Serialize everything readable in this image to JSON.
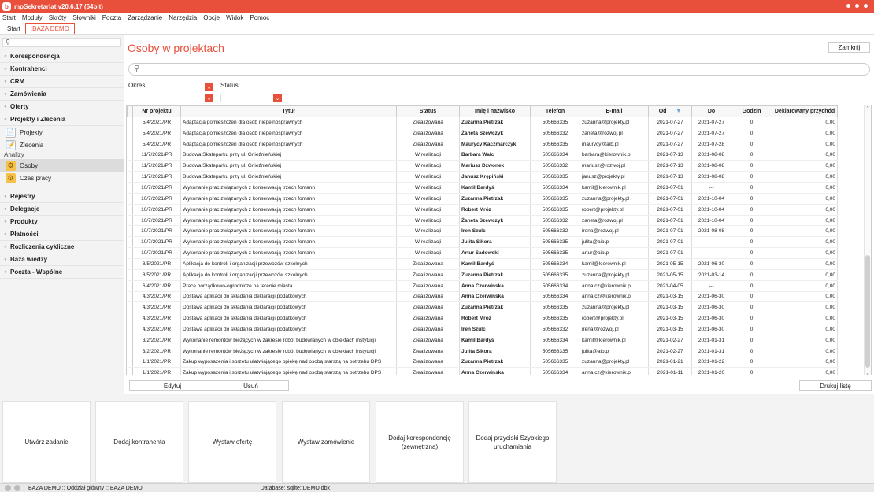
{
  "window": {
    "title": "mpSekretariat v20.6.17 (64bit)"
  },
  "menu": [
    "Start",
    "Moduły",
    "Skróty",
    "Słowniki",
    "Poczta",
    "Zarządzanie",
    "Narzędzia",
    "Opcje",
    "Widok",
    "Pomoc"
  ],
  "tabs": [
    "Start",
    ":BAZA DEMO"
  ],
  "sidebar": {
    "sections_top": [
      "Korespondencja",
      "Kontrahenci",
      "CRM",
      "Zamówienia",
      "Oferty",
      "Projekty i Zlecenia"
    ],
    "items_projects": [
      "Projekty",
      "Zlecenia"
    ],
    "analysis_label": "Analizy",
    "items_analysis": [
      "Osoby",
      "Czas pracy"
    ],
    "sections_bottom": [
      "Rejestry",
      "Delegacje",
      "Produkty",
      "Płatności",
      "Rozliczenia cykliczne",
      "Baza wiedzy",
      "Poczta - Wspólne"
    ]
  },
  "main": {
    "title": "Osoby w projektach",
    "close_label": "Zamknij",
    "filters": {
      "period_label": "Okres:",
      "status_label": "Status:"
    }
  },
  "table": {
    "columns": [
      "Nr projektu",
      "Tytuł",
      "Status",
      "Imię i nazwisko",
      "Telefon",
      "E-mail",
      "Od",
      "Do",
      "Godzin",
      "Deklarowany przychód"
    ],
    "rows": [
      [
        "5/4/2021/PR",
        "Adaptacja pomieszczeń dla osób niepełnosprawnych",
        "Zrealizowana",
        "Zuzanna Pietrzak",
        "505666335",
        "zuzanna@projekty.pl",
        "2021-07-27",
        "2021-07-27",
        "0",
        "0,00"
      ],
      [
        "5/4/2021/PR",
        "Adaptacja pomieszczeń dla osób niepełnosprawnych",
        "Zrealizowana",
        "Żaneta Szewczyk",
        "505666332",
        "zaneta@rozwoj.pl",
        "2021-07-27",
        "2021-07-27",
        "0",
        "0,00"
      ],
      [
        "5/4/2021/PR",
        "Adaptacja pomieszczeń dla osób niepełnosprawnych",
        "Zrealizowana",
        "Maurycy Kaczmarczyk",
        "505666335",
        "maurycy@aib.pl",
        "2021-07-27",
        "2021-07-28",
        "0",
        "0,00"
      ],
      [
        "11/7/2021/PR",
        "Budowa Skateparku przy ul. Gnieźnieńskiej",
        "W realizacji",
        "Barbara Walc",
        "505666334",
        "barbara@kierownik.pl",
        "2021-07-13",
        "2021-08-08",
        "0",
        "0,00"
      ],
      [
        "11/7/2021/PR",
        "Budowa Skateparku przy ul. Gnieźnieńskiej",
        "W realizacji",
        "Mariusz Dzwonek",
        "505666332",
        "mariusz@rozwoj.pl",
        "2021-07-13",
        "2021-08-08",
        "0",
        "0,00"
      ],
      [
        "11/7/2021/PR",
        "Budowa Skateparku przy ul. Gnieźnieńskiej",
        "W realizacji",
        "Janusz Krępiński",
        "505666335",
        "janusz@projekty.pl",
        "2021-07-13",
        "2021-08-08",
        "0",
        "0,00"
      ],
      [
        "10/7/2021/PR",
        "Wykonanie prac związanych z konserwacją trzech fontann",
        "W realizacji",
        "Kamil Bardyś",
        "505666334",
        "kamil@kierownik.pl",
        "2021-07-01",
        "---",
        "0",
        "0,00"
      ],
      [
        "10/7/2021/PR",
        "Wykonanie prac związanych z konserwacją trzech fontann",
        "W realizacji",
        "Zuzanna Pietrzak",
        "505666335",
        "zuzanna@projekty.pl",
        "2021-07-01",
        "2021-10-04",
        "0",
        "0,00"
      ],
      [
        "10/7/2021/PR",
        "Wykonanie prac związanych z konserwacją trzech fontann",
        "W realizacji",
        "Robert Mróz",
        "505666335",
        "robert@projekty.pl",
        "2021-07-01",
        "2021-10-04",
        "0",
        "0,00"
      ],
      [
        "10/7/2021/PR",
        "Wykonanie prac związanych z konserwacją trzech fontann",
        "W realizacji",
        "Żaneta Szewczyk",
        "505666332",
        "zaneta@rozwoj.pl",
        "2021-07-01",
        "2021-10-04",
        "0",
        "0,00"
      ],
      [
        "10/7/2021/PR",
        "Wykonanie prac związanych z konserwacją trzech fontann",
        "W realizacji",
        "Iren Szulc",
        "505666332",
        "irena@rozwoj.pl",
        "2021-07-01",
        "2021-08-08",
        "0",
        "0,00"
      ],
      [
        "10/7/2021/PR",
        "Wykonanie prac związanych z konserwacją trzech fontann",
        "W realizacji",
        "Julita Sikora",
        "505666335",
        "julita@aib.pl",
        "2021-07-01",
        "---",
        "0",
        "0,00"
      ],
      [
        "10/7/2021/PR",
        "Wykonanie prac związanych z konserwacją trzech fontann",
        "W realizacji",
        "Artur Sadowski",
        "505666335",
        "artur@aib.pl",
        "2021-07-01",
        "---",
        "0",
        "0,00"
      ],
      [
        "8/5/2021/PR",
        "Aplikacja do kontroli i organizacji przewozów szkolnych",
        "Zrealizowana",
        "Kamil Bardyś",
        "505666334",
        "kamil@kierownik.pl",
        "2021-05-15",
        "2021-06-30",
        "0",
        "0,00"
      ],
      [
        "8/5/2021/PR",
        "Aplikacja do kontroli i organizacji przewozów szkolnych",
        "Zrealizowana",
        "Zuzanna Pietrzak",
        "505666335",
        "zuzanna@projekty.pl",
        "2021-05-15",
        "2021-03-14",
        "0",
        "0,00"
      ],
      [
        "6/4/2021/PR",
        "Prace porządkowo-ogrodnicze na terenie miasta",
        "Zrealizowana",
        "Anna Czerwińska",
        "505666334",
        "anna.cz@kierownik.pl",
        "2021-04-05",
        "---",
        "0",
        "0,00"
      ],
      [
        "4/3/2021/PR",
        "Dostawa aplikacji do składania deklaracji podatkowych",
        "Zrealizowana",
        "Anna Czerwińska",
        "505666334",
        "anna.cz@kierownik.pl",
        "2021-03-15",
        "2021-06-30",
        "0",
        "0,00"
      ],
      [
        "4/3/2021/PR",
        "Dostawa aplikacji do składania deklaracji podatkowych",
        "Zrealizowana",
        "Zuzanna Pietrzak",
        "505666335",
        "zuzanna@projekty.pl",
        "2021-03-15",
        "2021-06-30",
        "0",
        "0,00"
      ],
      [
        "4/3/2021/PR",
        "Dostawa aplikacji do składania deklaracji podatkowych",
        "Zrealizowana",
        "Robert Mróz",
        "505666335",
        "robert@projekty.pl",
        "2021-03-15",
        "2021-06-30",
        "0",
        "0,00"
      ],
      [
        "4/3/2021/PR",
        "Dostawa aplikacji do składania deklaracji podatkowych",
        "Zrealizowana",
        "Iren Szulc",
        "505666332",
        "irena@rozwoj.pl",
        "2021-03-15",
        "2021-06-30",
        "0",
        "0,00"
      ],
      [
        "3/2/2021/PR",
        "Wykonanie remontów bieżących w zakresie robót budowlanych w obiektach instytucji",
        "Zrealizowana",
        "Kamil Bardyś",
        "505666334",
        "kamil@kierownik.pl",
        "2021-02-27",
        "2021-01-31",
        "0",
        "0,00"
      ],
      [
        "3/2/2021/PR",
        "Wykonanie remontów bieżących w zakresie robót budowlanych w obiektach instytucji",
        "Zrealizowana",
        "Julita Sikora",
        "505666335",
        "julita@aib.pl",
        "2021-02-27",
        "2021-01-31",
        "0",
        "0,00"
      ],
      [
        "1/1/2021/PR",
        "Zakup wyposażenia i sprzętu ułatwiającego opiekę nad osobą starszą na potrzebu DPS",
        "Zrealizowana",
        "Zuzanna Pietrzak",
        "505666335",
        "zuzanna@projekty.pl",
        "2021-01-21",
        "2021-01-22",
        "0",
        "0,00"
      ],
      [
        "1/1/2021/PR",
        "Zakup wyposażenia i sprzętu ułatwiającego opiekę nad osobą starszą na potrzebu DPS",
        "Zrealizowana",
        "Anna Czerwińska",
        "505666334",
        "anna.cz@kierownik.pl",
        "2021-01-11",
        "2021-01-20",
        "0",
        "0,00"
      ]
    ]
  },
  "buttons": {
    "edit": "Edytuj",
    "delete": "Usuń",
    "print": "Drukuj listę"
  },
  "quick_actions": [
    "Utwórz zadanie",
    "Dodaj kontrahenta",
    "Wystaw ofertę",
    "Wystaw zamówienie",
    "Dodaj korespondencję (zewnętrzną)",
    "Dodaj przyciski Szybkiego uruchamiania"
  ],
  "status": {
    "left": "BAZA DEMO :: Oddział główny :: BAZA DEMO",
    "database": "Database: sqlite::DEMO.dbx"
  },
  "colors": {
    "accent": "#e8503c"
  },
  "icons": {
    "sort": "sort-filter-icon"
  }
}
